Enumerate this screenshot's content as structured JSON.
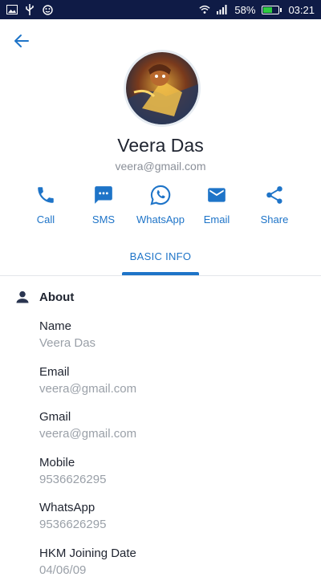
{
  "status_bar": {
    "battery_percent": "58%",
    "time": "03:21",
    "battery_level": 0.58,
    "icons": [
      "image-icon",
      "usb-icon",
      "smile-icon",
      "wifi-icon",
      "signal-icon",
      "battery-icon"
    ]
  },
  "header": {
    "back_icon": "arrow-left-icon"
  },
  "profile": {
    "name": "Veera Das",
    "email": "veera@gmail.com"
  },
  "actions": [
    {
      "label": "Call",
      "icon": "phone-icon"
    },
    {
      "label": "SMS",
      "icon": "sms-icon"
    },
    {
      "label": "WhatsApp",
      "icon": "whatsapp-icon"
    },
    {
      "label": "Email",
      "icon": "mail-icon"
    },
    {
      "label": "Share",
      "icon": "share-icon"
    }
  ],
  "tabs": {
    "active": "BASIC INFO"
  },
  "about": {
    "title": "About",
    "fields": [
      {
        "label": "Name",
        "value": "Veera Das"
      },
      {
        "label": "Email",
        "value": "veera@gmail.com"
      },
      {
        "label": "Gmail",
        "value": "veera@gmail.com"
      },
      {
        "label": "Mobile",
        "value": "9536626295"
      },
      {
        "label": "WhatsApp",
        "value": "9536626295"
      },
      {
        "label": "HKM Joining Date",
        "value": "04/06/09"
      }
    ]
  },
  "colors": {
    "accent": "#1e74c8",
    "status_bar": "#0f1b46",
    "battery": "#2ecc40"
  }
}
